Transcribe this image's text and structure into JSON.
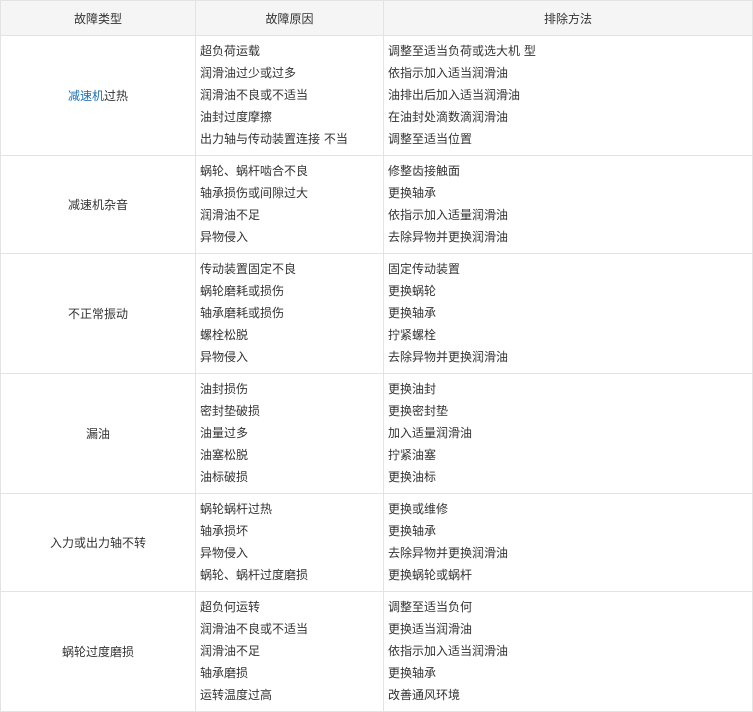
{
  "columns": [
    "故障类型",
    "故障原因",
    "排除方法"
  ],
  "rows": [
    {
      "type_link": "减速机",
      "type": "过热",
      "causes": [
        "超负荷运载",
        "润滑油过少或过多",
        "润滑油不良或不适当",
        "油封过度摩擦",
        "出力轴与传动装置连接 不当"
      ],
      "remedies": [
        "调整至适当负荷或选大机 型",
        "依指示加入适当润滑油",
        "油排出后加入适当润滑油",
        "在油封处滴数滴润滑油",
        "调整至适当位置"
      ]
    },
    {
      "type": "减速机杂音",
      "causes": [
        "蜗轮、蜗杆啮合不良",
        "轴承损伤或间隙过大",
        "润滑油不足",
        "异物侵入"
      ],
      "remedies": [
        "修整齿接触面",
        "更换轴承",
        "依指示加入适量润滑油",
        "去除异物并更换润滑油"
      ]
    },
    {
      "type": "不正常振动",
      "causes": [
        "传动装置固定不良",
        "蜗轮磨耗或损伤",
        "轴承磨耗或损伤",
        "螺栓松脱",
        "异物侵入"
      ],
      "remedies": [
        "固定传动装置",
        "更换蜗轮",
        "更换轴承",
        "拧紧螺栓",
        "去除异物并更换润滑油"
      ]
    },
    {
      "type": "漏油",
      "causes": [
        "油封损伤",
        "密封垫破损",
        "油量过多",
        "油塞松脱",
        "油标破损"
      ],
      "remedies": [
        "更换油封",
        "更换密封垫",
        "加入适量润滑油",
        "拧紧油塞",
        "更换油标"
      ]
    },
    {
      "type": "入力或出力轴不转",
      "causes": [
        "蜗轮蜗杆过热",
        "轴承损坏",
        "异物侵入",
        "蜗轮、蜗杆过度磨损"
      ],
      "remedies": [
        "更换或维修",
        "更换轴承",
        "去除异物并更换润滑油",
        "更换蜗轮或蜗杆"
      ]
    },
    {
      "type": "蜗轮过度磨损",
      "causes": [
        "超负何运转",
        "润滑油不良或不适当",
        "润滑油不足",
        "轴承磨损",
        "运转温度过高"
      ],
      "remedies": [
        "调整至适当负何",
        "更换适当润滑油",
        "依指示加入适当润滑油",
        "更换轴承",
        "改善通风环境"
      ]
    }
  ]
}
